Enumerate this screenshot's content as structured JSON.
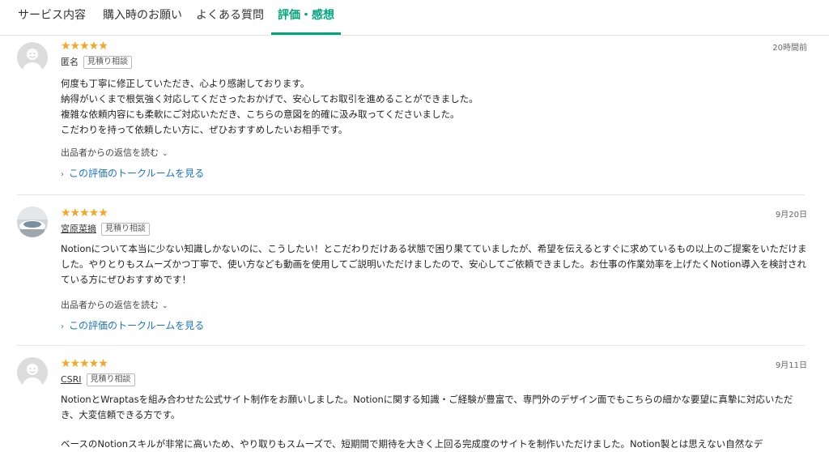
{
  "tabs": [
    {
      "label": "サービス内容"
    },
    {
      "label": "購入時のお願い"
    },
    {
      "label": "よくある質問"
    },
    {
      "label": "評価・感想",
      "active": true
    }
  ],
  "reviews": [
    {
      "stars": "★★★★★",
      "rating": 5,
      "name": "匿名",
      "badge": "見積り相談",
      "date": "20時間前",
      "avatar": "person-icon",
      "paragraphs": [
        "何度も丁寧に修正していただき、心より感謝しております。",
        "納得がいくまで根気強く対応してくださったおかげで、安心してお取引を進めることができました。",
        "複雑な依頼内容にも柔軟にご対応いただき、こちらの意図を的確に汲み取ってくださいました。",
        "こだわりを持って依頼したい方に、ぜひおすすめしたいお相手です。"
      ],
      "reply_label": "出品者からの返信を読む",
      "talkroom_label": "この評価のトークルームを見る"
    },
    {
      "stars": "★★★★★",
      "rating": 5,
      "name": "宮原菜摘",
      "badge": "見積り相談",
      "date": "9月20日",
      "avatar": "photo-avatar",
      "paragraphs": [
        "Notionについて本当に少ない知識しかないのに、こうしたい！とこだわりだけある状態で困り果てていましたが、希望を伝えるとすぐに求めているもの以上のご提案をいただけました。やりとりもスムーズかつ丁寧で、使い方なども動画を使用してご説明いただけましたので、安心してご依頼できました。お仕事の作業効率を上げたくNotion導入を検討されている方にぜひおすすめです！"
      ],
      "reply_label": "出品者からの返信を読む",
      "talkroom_label": "この評価のトークルームを見る"
    },
    {
      "stars": "★★★★★",
      "rating": 5,
      "name": "CSRI",
      "badge": "見積り相談",
      "date": "9月11日",
      "avatar": "person-icon",
      "paragraphs": [
        "NotionとWraptasを組み合わせた公式サイト制作をお願いしました。Notionに関する知識・ご経験が豊富で、専門外のデザイン面でもこちらの細かな要望に真摯に対応いただき、大変信頼できる方です。",
        "ベースのNotionスキルが非常に高いため、やり取りもスムーズで、短期間で期待を大きく上回る完成度のサイトを制作いただけました。Notion製とは思えない自然なデ"
      ]
    }
  ],
  "colors": {
    "accent": "#00a47a",
    "star": "#f5a623",
    "link": "#1a73c7"
  }
}
